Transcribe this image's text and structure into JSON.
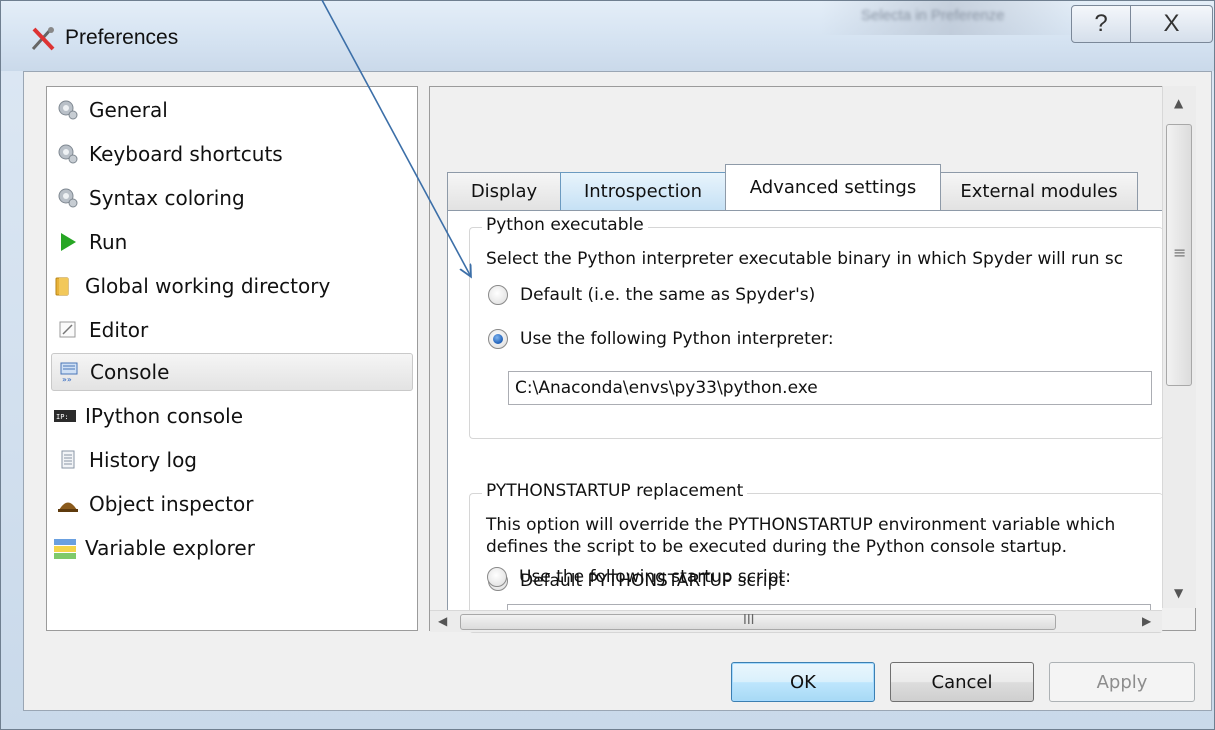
{
  "window": {
    "title": "Preferences",
    "background_title": "Selecta in Preferenze",
    "help_glyph": "?",
    "close_glyph": "X"
  },
  "sidebar": {
    "items": [
      {
        "label": "General",
        "icon": "gear-icon"
      },
      {
        "label": "Keyboard shortcuts",
        "icon": "gear-icon"
      },
      {
        "label": "Syntax coloring",
        "icon": "gear-icon"
      },
      {
        "label": "Run",
        "icon": "play-icon"
      },
      {
        "label": "Global working directory",
        "icon": "folder-icon"
      },
      {
        "label": "Editor",
        "icon": "editor-icon"
      },
      {
        "label": "Console",
        "icon": "console-icon",
        "selected": true
      },
      {
        "label": "IPython console",
        "icon": "ipython-icon"
      },
      {
        "label": "History log",
        "icon": "history-icon"
      },
      {
        "label": "Object inspector",
        "icon": "inspector-icon"
      },
      {
        "label": "Variable explorer",
        "icon": "variable-explorer-icon"
      }
    ]
  },
  "tabs": [
    {
      "label": "Display"
    },
    {
      "label": "Introspection"
    },
    {
      "label": "Advanced settings",
      "active": true
    },
    {
      "label": "External modules"
    }
  ],
  "python_exec": {
    "group_title": "Python executable",
    "description": "Select the Python interpreter executable binary in which Spyder will run sc",
    "option_default": "Default (i.e. the same as Spyder's)",
    "option_custom": "Use the following Python interpreter:",
    "selected": "custom",
    "path_value": "C:\\Anaconda\\envs\\py33\\python.exe"
  },
  "startup": {
    "group_title": "PYTHONSTARTUP replacement",
    "description_line1": "This option will override the PYTHONSTARTUP environment variable which",
    "description_line2": "defines the script to be executed during the Python console startup.",
    "option_default": "Default PYTHONSTARTUP script",
    "option_custom": "Use the following startup script:",
    "selected": "default"
  },
  "scrollbar": {
    "hscroll_grip": "III",
    "vscroll_grip": "≡"
  },
  "buttons": {
    "ok": "OK",
    "cancel": "Cancel",
    "apply": "Apply"
  },
  "colors": {
    "accent": "#1e5fb8",
    "arrow": "#3c6fa8",
    "selection": "#e3e3e3"
  }
}
